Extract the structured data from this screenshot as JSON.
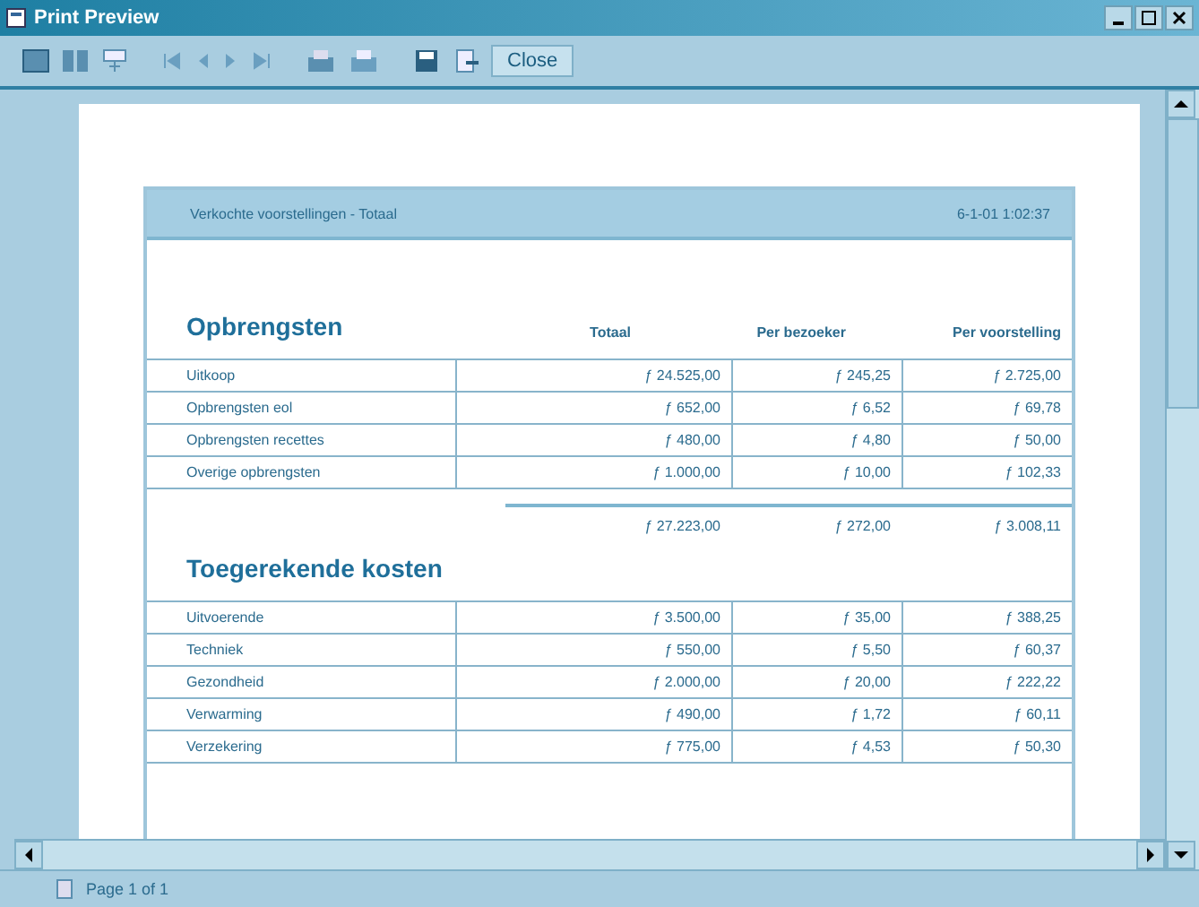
{
  "window": {
    "title": "Print Preview"
  },
  "toolbar": {
    "close_label": "Close"
  },
  "report": {
    "header_left": "Verkochte voorstellingen - Totaal",
    "header_right": "6-1-01 1:02:37",
    "sections": [
      {
        "title": "Opbrengsten",
        "columns": [
          "Totaal",
          "Per bezoeker",
          "Per voorstelling"
        ],
        "rows": [
          {
            "label": "Uitkoop",
            "values": [
              "ƒ 24.525,00",
              "ƒ 245,25",
              "ƒ 2.725,00"
            ]
          },
          {
            "label": "Opbrengsten eol",
            "values": [
              "ƒ 652,00",
              "ƒ 6,52",
              "ƒ 69,78"
            ]
          },
          {
            "label": "Opbrengsten recettes",
            "values": [
              "ƒ 480,00",
              "ƒ 4,80",
              "ƒ 50,00"
            ]
          },
          {
            "label": "Overige opbrengsten",
            "values": [
              "ƒ 1.000,00",
              "ƒ 10,00",
              "ƒ 102,33"
            ]
          }
        ],
        "totals": [
          "ƒ 27.223,00",
          "ƒ 272,00",
          "ƒ 3.008,11"
        ]
      },
      {
        "title": "Toegerekende kosten",
        "rows": [
          {
            "label": "Uitvoerende",
            "values": [
              "ƒ 3.500,00",
              "ƒ 35,00",
              "ƒ 388,25"
            ]
          },
          {
            "label": "Techniek",
            "values": [
              "ƒ 550,00",
              "ƒ 5,50",
              "ƒ 60,37"
            ]
          },
          {
            "label": "Gezondheid",
            "values": [
              "ƒ 2.000,00",
              "ƒ 20,00",
              "ƒ 222,22"
            ]
          },
          {
            "label": "Verwarming",
            "values": [
              "ƒ 490,00",
              "ƒ 1,72",
              "ƒ 60,11"
            ]
          },
          {
            "label": "Verzekering",
            "values": [
              "ƒ 775,00",
              "ƒ 4,53",
              "ƒ 50,30"
            ]
          }
        ]
      }
    ]
  },
  "status_bar": {
    "page": "Page 1 of 1"
  }
}
